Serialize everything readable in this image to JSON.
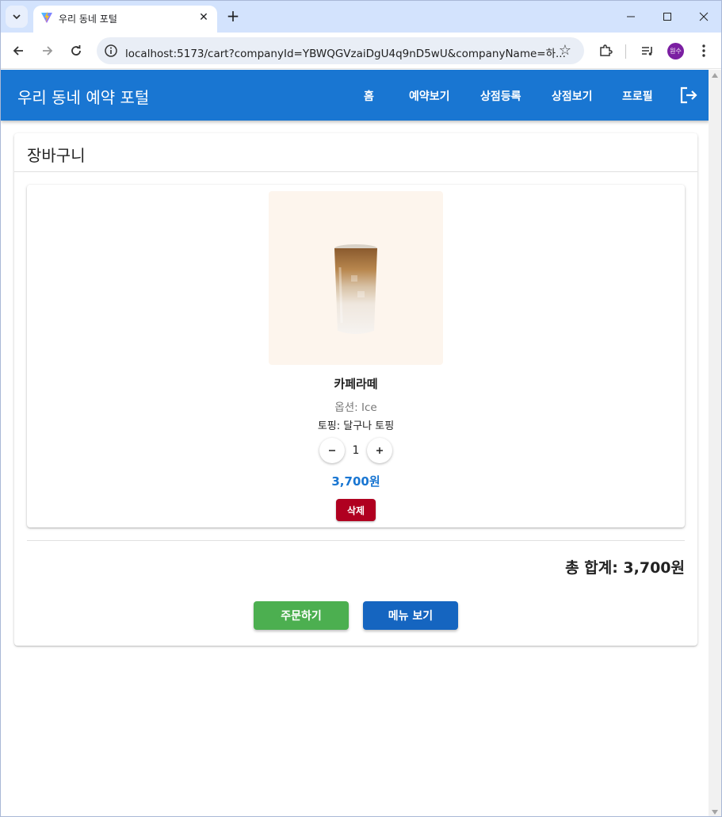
{
  "browser": {
    "tab_title": "우리 동네 포털",
    "url": "localhost:5173/cart?companyId=YBWQGVzaiDgU4q9nD5wU&companyName=하...",
    "profile_initials": "원수"
  },
  "app": {
    "brand": "우리 동네 예약 포털",
    "nav": [
      "홈",
      "예약보기",
      "상점등록",
      "상점보기",
      "프로필"
    ],
    "colors": {
      "primary": "#1976d2",
      "delete": "#b00020",
      "order": "#4caf50"
    }
  },
  "cart": {
    "title": "장바구니",
    "items": [
      {
        "name": "카페라떼",
        "option": "옵션: Ice",
        "topping": "토핑: 달구나 토핑",
        "quantity": "1",
        "price": "3,700원",
        "delete_label": "삭제"
      }
    ],
    "total": "총 합계: 3,700원",
    "order_label": "주문하기",
    "menu_label": "메뉴 보기"
  }
}
